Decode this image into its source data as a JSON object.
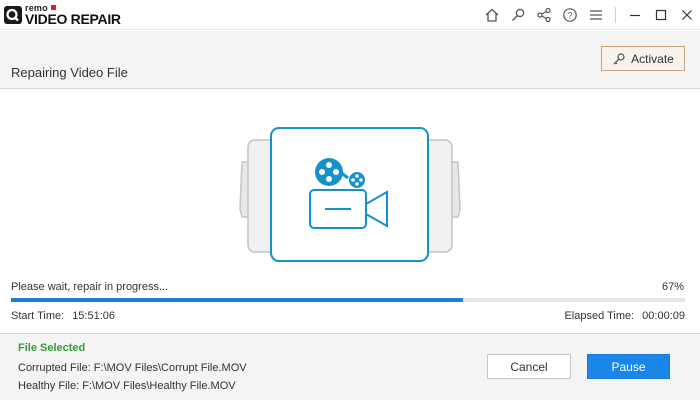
{
  "app": {
    "brand": "remo",
    "product": "VIDEO REPAIR"
  },
  "titlebar": {
    "icons": [
      "home-icon",
      "search-key-icon",
      "share-icon",
      "help-icon",
      "minimize-icon",
      "maximize-icon",
      "close-icon"
    ]
  },
  "header": {
    "title": "Repairing Video File",
    "activate_label": "Activate"
  },
  "progress": {
    "status": "Please wait, repair in progress...",
    "percent_label": "67%",
    "value": 0.67,
    "start_label": "Start Time:",
    "start_value": "15:51:06",
    "elapsed_label": "Elapsed Time:",
    "elapsed_value": "00:00:09"
  },
  "footer": {
    "file_selected": "File Selected",
    "corrupted": "Corrupted File: F:\\MOV Files\\Corrupt File.MOV",
    "healthy": "Healthy File: F:\\MOV Files\\Healthy File.MOV",
    "cancel_label": "Cancel",
    "pause_label": "Pause"
  },
  "colors": {
    "accent": "#1a86e8",
    "progress": "#1e7fd0",
    "illustration": "#1592c8",
    "success": "#3a9a36",
    "activate_border": "#c9a57b"
  }
}
